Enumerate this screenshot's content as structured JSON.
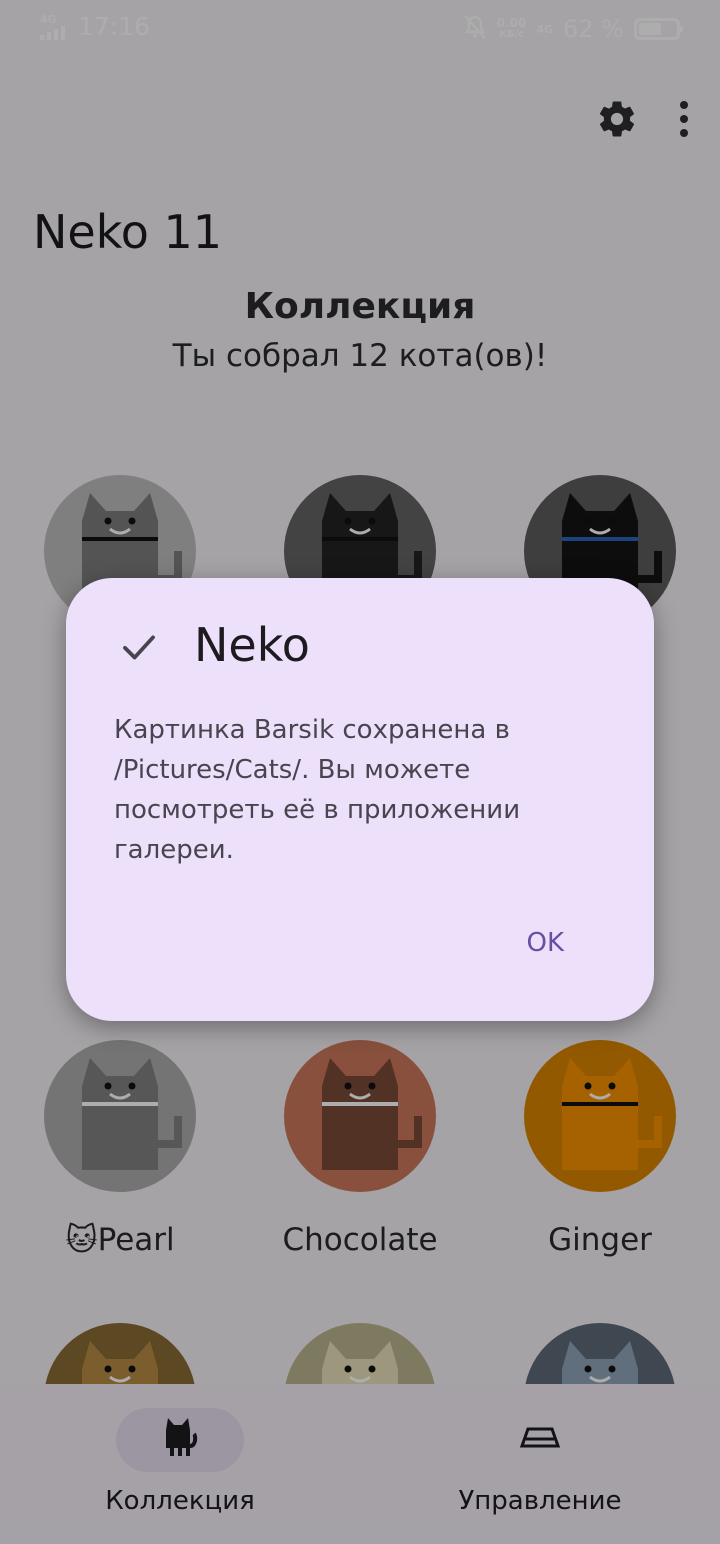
{
  "status_bar": {
    "network_left": "4G",
    "time": "17:16",
    "speed_value": "0.00",
    "speed_unit": "КБ/с",
    "network_right": "4G",
    "battery_text": "62 %",
    "battery_level": 0.62
  },
  "toolbar": {
    "settings_icon": "gear-icon",
    "menu_icon": "more-vert-icon"
  },
  "app": {
    "title": "Neko 11",
    "section_title": "Коллекция",
    "section_subtitle": "Ты собрал 12 кота(ов)!"
  },
  "cats": [
    {
      "name": "",
      "bg": "#bcbcbc",
      "body": "#7d7d7d",
      "collar": "#111111"
    },
    {
      "name": "",
      "bg": "#636363",
      "body": "#222222",
      "collar": "#111111"
    },
    {
      "name": "",
      "bg": "#5c5c5c",
      "body": "#141414",
      "collar": "#2a63b8"
    },
    {
      "name": "🐱Pearl",
      "bg": "#ababab",
      "body": "#808080",
      "collar": "#ffffff"
    },
    {
      "name": "Chocolate",
      "bg": "#c9765b",
      "body": "#7b4a38",
      "collar": "#ffffff"
    },
    {
      "name": "Ginger",
      "bg": "#d98400",
      "body": "#f58f00",
      "collar": "#111111"
    },
    {
      "name": "",
      "bg": "#8a6a36",
      "body": "#b58a44",
      "collar": "#111111"
    },
    {
      "name": "",
      "bg": "#b9b48c",
      "body": "#e8e1b8",
      "collar": "#111111"
    },
    {
      "name": "",
      "bg": "#5d6a78",
      "body": "#8fa3b7",
      "collar": "#111111"
    }
  ],
  "bottom_nav": {
    "items": [
      {
        "label": "Коллекция",
        "icon": "cat-icon"
      },
      {
        "label": "Управление",
        "icon": "tray-icon"
      }
    ]
  },
  "dialog": {
    "title": "Neko",
    "icon": "check-icon",
    "message": "Картинка Barsik сохранена в /Pictures/Cats/. Вы можете посмотреть её в приложении галереи.",
    "ok_label": "OK"
  }
}
